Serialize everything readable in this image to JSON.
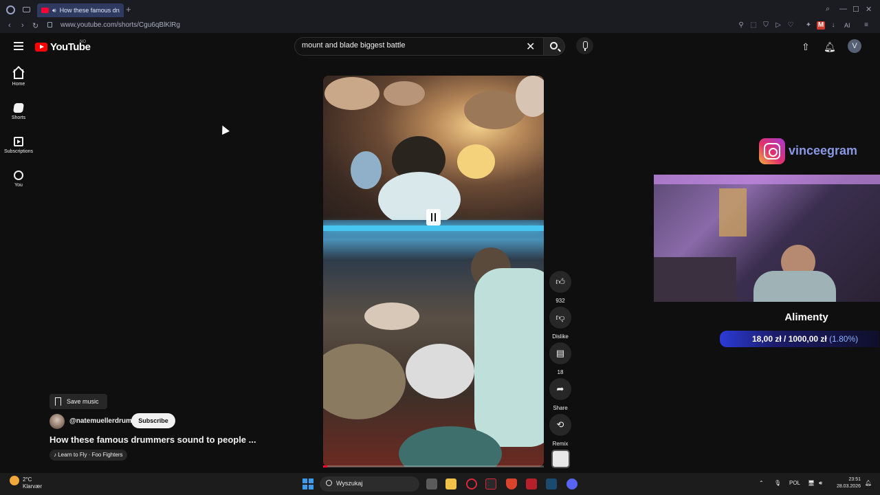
{
  "browser": {
    "tab_title": "How these famous dru",
    "url": "www.youtube.com/shorts/Cgu6qBlKlRg",
    "ai_label": "AI",
    "ext_m": "M"
  },
  "header": {
    "logo_text": "YouTube",
    "country": "NO",
    "search_value": "mount and blade biggest battle",
    "avatar_letter": "V"
  },
  "sidebar": {
    "items": [
      {
        "label": "Home",
        "icon": "home-icon"
      },
      {
        "label": "Shorts",
        "icon": "shorts-icon"
      },
      {
        "label": "Subscriptions",
        "icon": "subscriptions-icon"
      },
      {
        "label": "You",
        "icon": "you-icon"
      }
    ]
  },
  "video": {
    "progress": 0.02,
    "accent": "#ff0033"
  },
  "actions": {
    "like_count": "932",
    "dislike_label": "Dislike",
    "comment_count": "18",
    "share_label": "Share",
    "remix_label": "Remix"
  },
  "meta": {
    "save_music": "Save music",
    "channel": "@natemuellerdrums",
    "subscribe": "Subscribe",
    "title": "How these famous drummers sound to people ...",
    "song": "Learn to Fly · Foo Fighters"
  },
  "overlay": {
    "instagram": "vinceegram",
    "goal_title": "Alimenty",
    "goal_amount": "18,00 zł / 1000,00 zł",
    "goal_pct": "(1.80%)"
  },
  "taskbar": {
    "temp": "2°C",
    "weather": "Klarvær",
    "search_placeholder": "Wyszukaj",
    "lang": "POL",
    "time": "23:51",
    "date": "28.03.2026"
  }
}
